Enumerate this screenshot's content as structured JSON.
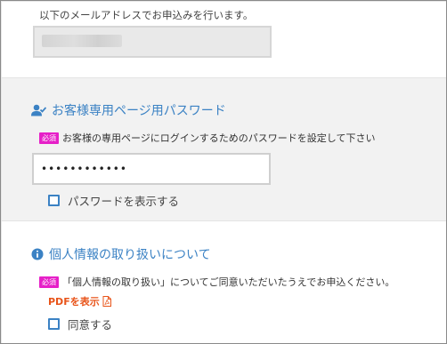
{
  "email_section": {
    "note": "以下のメールアドレスでお申込みを行います。",
    "email_value": ""
  },
  "password_section": {
    "heading": "お客様専用ページ用パスワード",
    "heading_icon": "user-check-icon",
    "required_badge": "必須",
    "instruction": "お客様の専用ページにログインするためのパスワードを設定して下さい",
    "password_value": "••••••••••••",
    "show_password_label": "パスワードを表示する",
    "show_password_checked": false
  },
  "privacy_section": {
    "heading": "個人情報の取り扱いについて",
    "heading_icon": "info-circle-icon",
    "required_badge": "必須",
    "instruction": "「個人情報の取り扱い」についてご同意いただいたうえでお申込ください。",
    "pdf_link_label": "PDFを表示",
    "pdf_icon": "pdf-file-icon",
    "agree_label": "同意する",
    "agree_checked": false
  },
  "colors": {
    "accent_blue": "#3b82c4",
    "badge_magenta": "#e620c8",
    "pdf_orange": "#e8541a",
    "section_gray": "#f2f2f2"
  }
}
